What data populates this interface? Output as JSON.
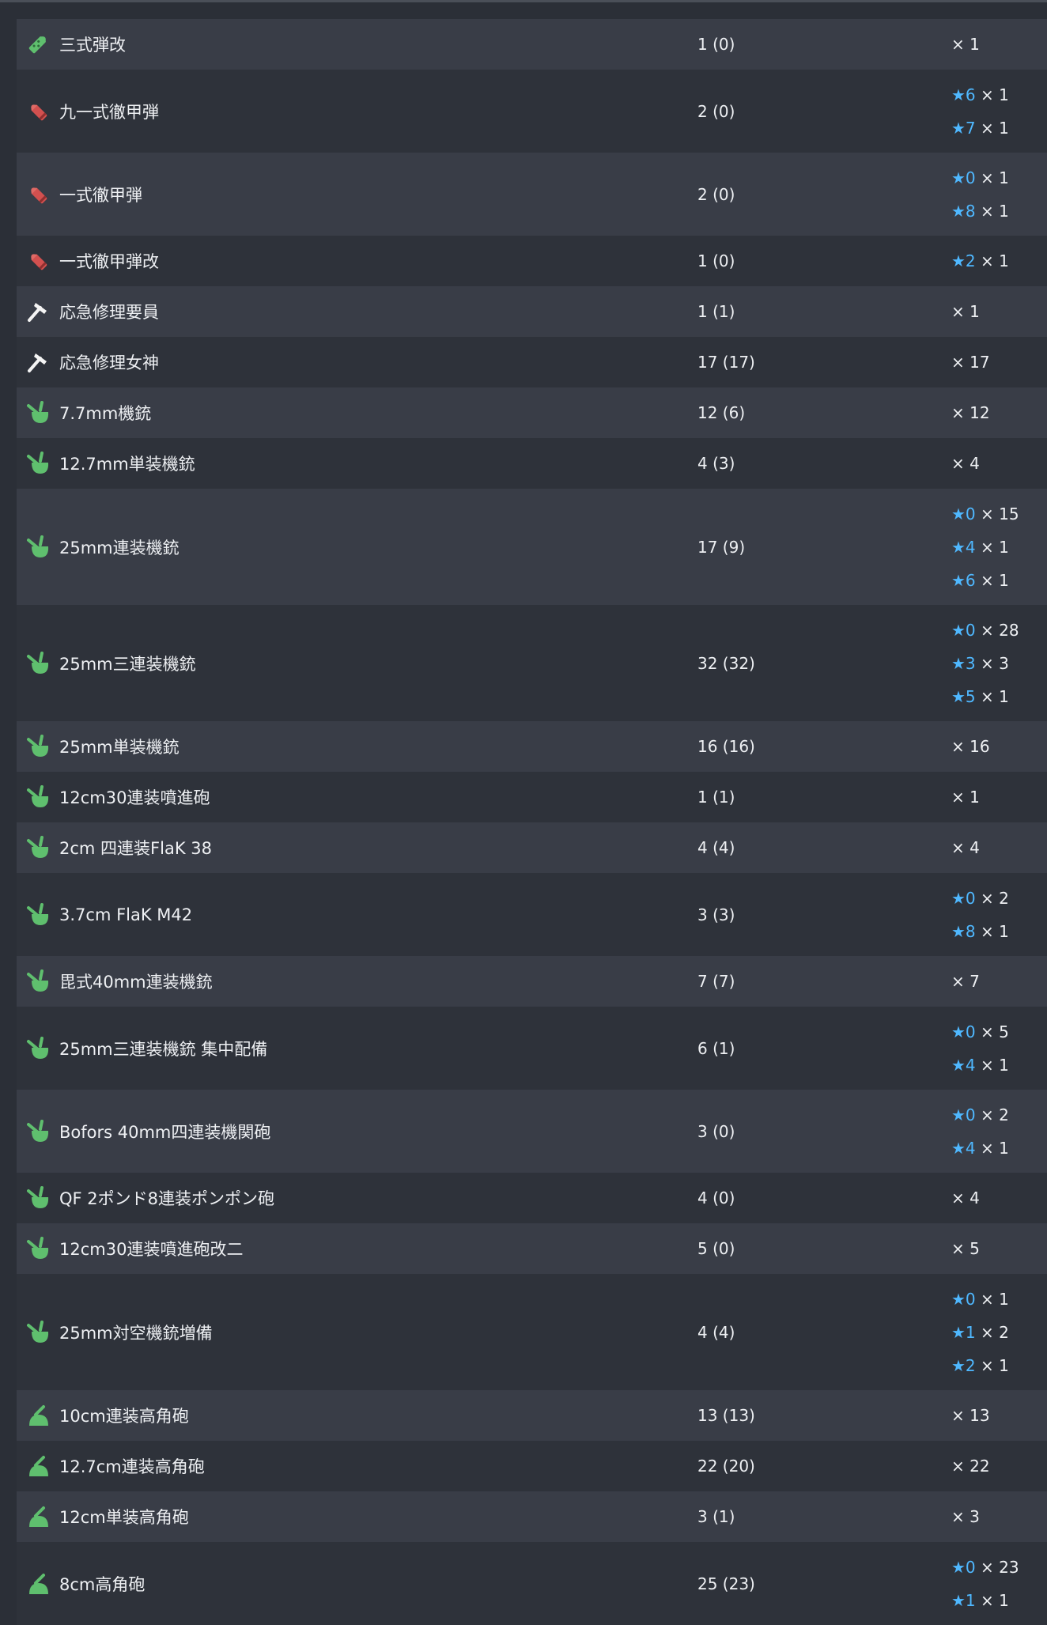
{
  "rows": [
    {
      "icon": "shell-green-icon",
      "name": "三式弾改",
      "count": "1 (0)",
      "levels": [
        {
          "star": "",
          "qty": "× 1"
        }
      ]
    },
    {
      "icon": "shell-red-icon",
      "name": "九一式徹甲弾",
      "count": "2 (0)",
      "levels": [
        {
          "star": "★6",
          "qty": " × 1"
        },
        {
          "star": "★7",
          "qty": " × 1"
        }
      ]
    },
    {
      "icon": "shell-red-icon",
      "name": "一式徹甲弾",
      "count": "2 (0)",
      "levels": [
        {
          "star": "★0",
          "qty": " × 1"
        },
        {
          "star": "★8",
          "qty": " × 1"
        }
      ]
    },
    {
      "icon": "shell-red-icon",
      "name": "一式徹甲弾改",
      "count": "1 (0)",
      "levels": [
        {
          "star": "★2",
          "qty": " × 1"
        }
      ]
    },
    {
      "icon": "repair-hammer-icon",
      "name": "応急修理要員",
      "count": "1 (1)",
      "levels": [
        {
          "star": "",
          "qty": "× 1"
        }
      ]
    },
    {
      "icon": "repair-hammer-icon",
      "name": "応急修理女神",
      "count": "17 (17)",
      "levels": [
        {
          "star": "",
          "qty": "× 17"
        }
      ]
    },
    {
      "icon": "aa-gun-icon",
      "name": "7.7mm機銃",
      "count": "12 (6)",
      "levels": [
        {
          "star": "",
          "qty": "× 12"
        }
      ]
    },
    {
      "icon": "aa-gun-icon",
      "name": "12.7mm単装機銃",
      "count": "4 (3)",
      "levels": [
        {
          "star": "",
          "qty": "× 4"
        }
      ]
    },
    {
      "icon": "aa-gun-icon",
      "name": "25mm連装機銃",
      "count": "17 (9)",
      "levels": [
        {
          "star": "★0",
          "qty": " × 15"
        },
        {
          "star": "★4",
          "qty": " × 1"
        },
        {
          "star": "★6",
          "qty": " × 1"
        }
      ]
    },
    {
      "icon": "aa-gun-icon",
      "name": "25mm三連装機銃",
      "count": "32 (32)",
      "levels": [
        {
          "star": "★0",
          "qty": " × 28"
        },
        {
          "star": "★3",
          "qty": " × 3"
        },
        {
          "star": "★5",
          "qty": " × 1"
        }
      ]
    },
    {
      "icon": "aa-gun-icon",
      "name": "25mm単装機銃",
      "count": "16 (16)",
      "levels": [
        {
          "star": "",
          "qty": "× 16"
        }
      ]
    },
    {
      "icon": "aa-gun-icon",
      "name": "12cm30連装噴進砲",
      "count": "1 (1)",
      "levels": [
        {
          "star": "",
          "qty": "× 1"
        }
      ]
    },
    {
      "icon": "aa-gun-icon",
      "name": "2cm 四連装FlaK 38",
      "count": "4 (4)",
      "levels": [
        {
          "star": "",
          "qty": "× 4"
        }
      ]
    },
    {
      "icon": "aa-gun-icon",
      "name": "3.7cm FlaK M42",
      "count": "3 (3)",
      "levels": [
        {
          "star": "★0",
          "qty": " × 2"
        },
        {
          "star": "★8",
          "qty": " × 1"
        }
      ]
    },
    {
      "icon": "aa-gun-icon",
      "name": "毘式40mm連装機銃",
      "count": "7 (7)",
      "levels": [
        {
          "star": "",
          "qty": "× 7"
        }
      ]
    },
    {
      "icon": "aa-gun-icon",
      "name": "25mm三連装機銃 集中配備",
      "count": "6 (1)",
      "levels": [
        {
          "star": "★0",
          "qty": " × 5"
        },
        {
          "star": "★4",
          "qty": " × 1"
        }
      ]
    },
    {
      "icon": "aa-gun-icon",
      "name": "Bofors 40mm四連装機関砲",
      "count": "3 (0)",
      "levels": [
        {
          "star": "★0",
          "qty": " × 2"
        },
        {
          "star": "★4",
          "qty": " × 1"
        }
      ]
    },
    {
      "icon": "aa-gun-icon",
      "name": "QF 2ポンド8連装ポンポン砲",
      "count": "4 (0)",
      "levels": [
        {
          "star": "",
          "qty": "× 4"
        }
      ]
    },
    {
      "icon": "aa-gun-icon",
      "name": "12cm30連装噴進砲改二",
      "count": "5 (0)",
      "levels": [
        {
          "star": "",
          "qty": "× 5"
        }
      ]
    },
    {
      "icon": "aa-gun-icon",
      "name": "25mm対空機銃増備",
      "count": "4 (4)",
      "levels": [
        {
          "star": "★0",
          "qty": " × 1"
        },
        {
          "star": "★1",
          "qty": " × 2"
        },
        {
          "star": "★2",
          "qty": " × 1"
        }
      ]
    },
    {
      "icon": "ha-gun-icon",
      "name": "10cm連装高角砲",
      "count": "13 (13)",
      "levels": [
        {
          "star": "",
          "qty": "× 13"
        }
      ]
    },
    {
      "icon": "ha-gun-icon",
      "name": "12.7cm連装高角砲",
      "count": "22 (20)",
      "levels": [
        {
          "star": "",
          "qty": "× 22"
        }
      ]
    },
    {
      "icon": "ha-gun-icon",
      "name": "12cm単装高角砲",
      "count": "3 (1)",
      "levels": [
        {
          "star": "",
          "qty": "× 3"
        }
      ]
    },
    {
      "icon": "ha-gun-icon",
      "name": "8cm高角砲",
      "count": "25 (23)",
      "levels": [
        {
          "star": "★0",
          "qty": " × 23"
        },
        {
          "star": "★1",
          "qty": " × 1"
        }
      ]
    }
  ],
  "colors": {
    "star": "#4fb8ff",
    "row_odd": "#393d47",
    "row_even": "#2e323a",
    "bg": "#2b2f37"
  }
}
